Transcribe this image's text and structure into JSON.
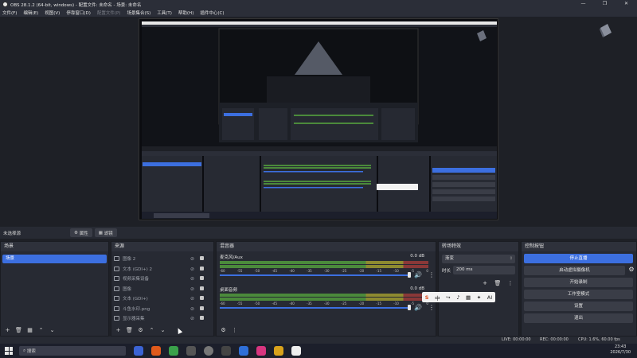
{
  "window": {
    "title": "OBS 28.1.2 (64-bit, windows) - 配置文件: 未命名 - 场景: 未命名",
    "minimize": "—",
    "maximize": "❐",
    "close": "✕"
  },
  "menu": {
    "items": [
      {
        "label": "文件(F)",
        "enabled": true
      },
      {
        "label": "编辑(E)",
        "enabled": true
      },
      {
        "label": "视图(V)",
        "enabled": true
      },
      {
        "label": "停靠窗口(D)",
        "enabled": true
      },
      {
        "label": "配置文件(P)",
        "enabled": false
      },
      {
        "label": "场景集合(S)",
        "enabled": true
      },
      {
        "label": "工具(T)",
        "enabled": true
      },
      {
        "label": "帮助(H)",
        "enabled": true
      },
      {
        "label": "插件中心(C)",
        "enabled": true
      }
    ]
  },
  "scene_bar": {
    "no_source": "未选择源",
    "properties": "属性",
    "filters": "滤镜"
  },
  "scenes": {
    "title": "场景",
    "items": [
      "场景"
    ]
  },
  "sources": {
    "title": "来源",
    "items": [
      {
        "label": "图像 2"
      },
      {
        "label": "文本 (GDI+) 2"
      },
      {
        "label": "视频采集设备"
      },
      {
        "label": "图像"
      },
      {
        "label": "文本 (GDI+)"
      },
      {
        "label": "斗鱼水印.png"
      },
      {
        "label": "显示器采集"
      }
    ]
  },
  "mixer": {
    "title": "混音器",
    "channels": [
      {
        "name": "麦克风/Aux",
        "db": "0.0 dB"
      },
      {
        "name": "桌面音频",
        "db": "0.0 dB"
      }
    ],
    "ticks": [
      "-60",
      "-55",
      "-50",
      "-45",
      "-40",
      "-35",
      "-30",
      "-25",
      "-20",
      "-15",
      "-10",
      "-5",
      "0"
    ]
  },
  "transitions": {
    "title": "转场特效",
    "selected": "渐变",
    "duration_label": "时长",
    "duration_value": "200 ms"
  },
  "controls": {
    "title": "控制按钮",
    "buttons": [
      {
        "label": "停止直播",
        "active": true
      },
      {
        "label": "启动虚拟摄像机",
        "active": false
      },
      {
        "label": "开始录制",
        "active": false
      },
      {
        "label": "工作室模式",
        "active": false
      },
      {
        "label": "设置",
        "active": false
      },
      {
        "label": "退出",
        "active": false
      }
    ]
  },
  "status": {
    "live": "LIVE: 00:00:00",
    "rec": "REC: 00:00:00",
    "cpu": "CPU: 1.6%, 60.00 fps"
  },
  "taskbar": {
    "search": "搜索",
    "time": "23:43",
    "date": "2026/7/30"
  },
  "ime": {
    "items": [
      "S",
      "中",
      "↪",
      "♪",
      "▦",
      "✦",
      "AI"
    ]
  },
  "colors": {
    "accent": "#3c6fe0",
    "panel": "#272a33",
    "background": "#1e2026"
  }
}
